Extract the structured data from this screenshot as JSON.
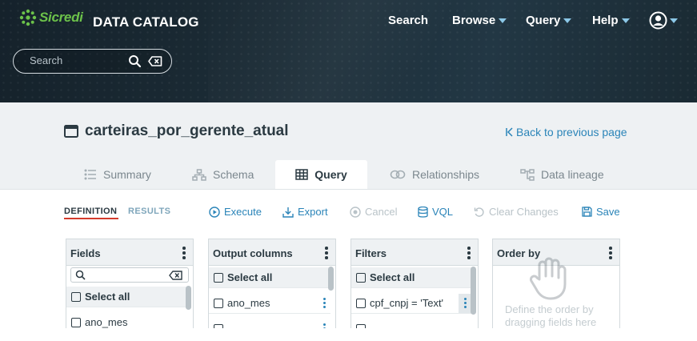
{
  "brand": {
    "logo_text": "Sicredi",
    "app_title": "DATA CATALOG",
    "logo_color": "#6cc24a"
  },
  "nav": {
    "search": "Search",
    "browse": "Browse",
    "query": "Query",
    "help": "Help"
  },
  "search": {
    "placeholder": "Search"
  },
  "view": {
    "name": "carteiras_por_gerente_atual",
    "back_link": "Back to previous page"
  },
  "tabs": [
    {
      "label": "Summary",
      "icon": "list-icon"
    },
    {
      "label": "Schema",
      "icon": "hierarchy-icon"
    },
    {
      "label": "Query",
      "icon": "table-icon",
      "active": true
    },
    {
      "label": "Relationships",
      "icon": "link-icon"
    },
    {
      "label": "Data lineage",
      "icon": "lineage-icon"
    }
  ],
  "subtabs": {
    "definition": "DEFINITION",
    "results": "RESULTS"
  },
  "actions": {
    "execute": "Execute",
    "export": "Export",
    "cancel": "Cancel",
    "vql": "VQL",
    "clear_changes": "Clear Changes",
    "save": "Save"
  },
  "panels": {
    "fields": {
      "title": "Fields",
      "select_all": "Select all",
      "items": [
        "ano_mes"
      ]
    },
    "output_columns": {
      "title": "Output columns",
      "select_all": "Select all",
      "items": [
        "ano_mes"
      ]
    },
    "filters": {
      "title": "Filters",
      "select_all": "Select all",
      "items": [
        "cpf_cnpj = 'Text'"
      ]
    },
    "order_by": {
      "title": "Order by",
      "empty_text": "Define the order by dragging fields here"
    }
  },
  "colors": {
    "accent": "#2a84b8",
    "active_underline": "#d33b2c",
    "header_bg": "#1b2b35"
  }
}
